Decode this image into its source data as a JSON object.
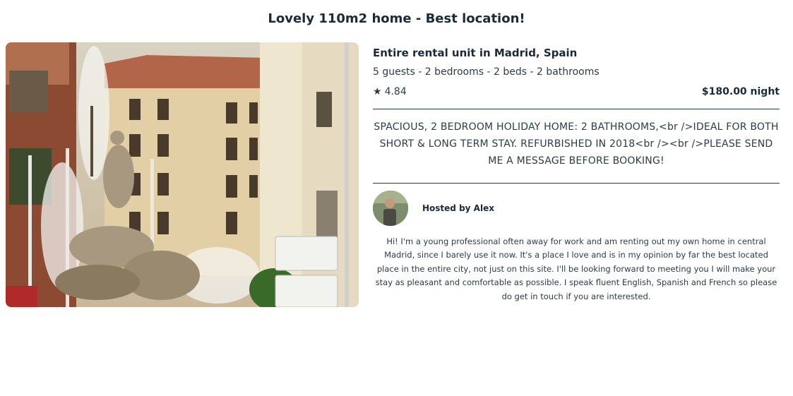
{
  "listing": {
    "title": "Lovely 110m2 home - Best location!",
    "unit_title": "Entire rental unit in Madrid, Spain",
    "specs": "5 guests - 2 bedrooms - 2 beds - 2 bathrooms",
    "rating_icon": "★",
    "rating": "4.84",
    "price": "$180.00 night",
    "summary": "SPACIOUS, 2 BEDROOM HOLIDAY HOME: 2 BATHROOMS,<br />IDEAL FOR BOTH SHORT & LONG TERM STAY. REFURBISHED IN 2018<br /><br />PLEASE SEND ME A MESSAGE BEFORE BOOKING!"
  },
  "host": {
    "name": "Hosted by Alex",
    "about": "Hi! I'm a young professional often away for work and am renting out my own home in central Madrid, since I barely use it now. It's a place I love and is in my opinion by far the best located place in the entire city, not just on this site. I'll be looking forward to meeting you I will make your stay as pleasant and comfortable as possible. I speak fluent English, Spanish and French so please do get in touch if you are interested."
  },
  "colors": {
    "text_dark": "#1a2a3a",
    "divider": "#1f3a4a"
  }
}
